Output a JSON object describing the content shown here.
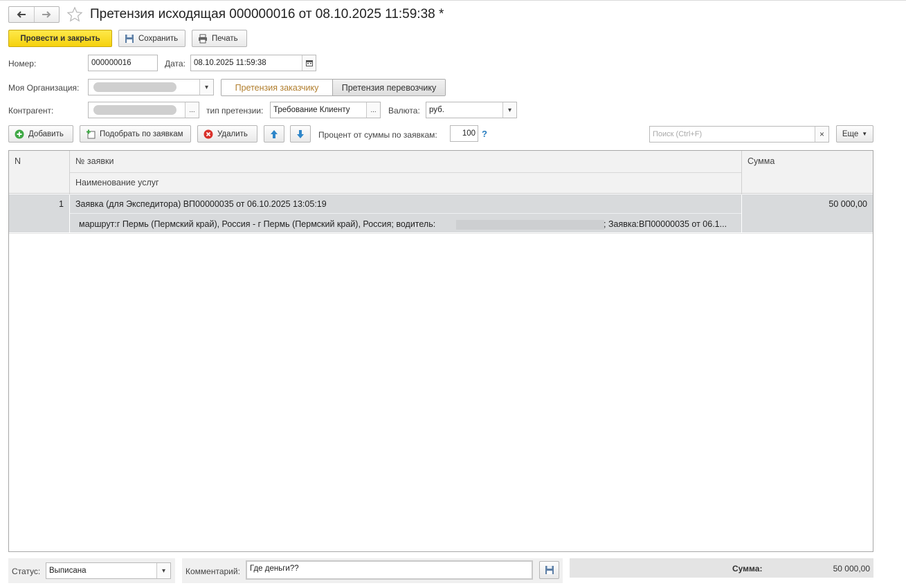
{
  "window": {
    "title": "Претензия исходящая 000000016 от 08.10.2025 11:59:38 *"
  },
  "toolbar": {
    "post_close": "Провести и закрыть",
    "save": "Сохранить",
    "print": "Печать"
  },
  "form": {
    "number_label": "Номер:",
    "number_value": "000000016",
    "date_label": "Дата:",
    "date_value": "08.10.2025 11:59:38",
    "org_label": "Моя Организация:",
    "counterparty_label": "Контрагент:",
    "claim_type_label": "тип претензии:",
    "claim_type_value": "Требование Клиенту",
    "currency_label": "Валюта:",
    "currency_value": "руб.",
    "tabs": [
      "Претензия заказчику",
      "Претензия перевозчику"
    ]
  },
  "table_toolbar": {
    "add": "Добавить",
    "pick": "Подобрать по заявкам",
    "delete": "Удалить",
    "percent_label": "Процент от суммы по заявкам:",
    "percent_value": "100",
    "help": "?",
    "search_placeholder": "Поиск (Ctrl+F)",
    "more": "Еще"
  },
  "table": {
    "headers": {
      "n": "N",
      "order": "№ заявки",
      "services": "Наименование услуг",
      "sum": "Сумма"
    },
    "rows": [
      {
        "n": "1",
        "order": "Заявка (для Экспедитора) ВП00000035 от 06.10.2025 13:05:19",
        "services_prefix": "маршрут:г Пермь (Пермский край), Россия - г Пермь (Пермский край), Россия; водитель:",
        "services_suffix": "; Заявка:ВП00000035 от 06.1...",
        "sum": "50 000,00"
      }
    ]
  },
  "footer": {
    "status_label": "Статус:",
    "status_value": "Выписана",
    "comment_label": "Комментарий:",
    "comment_value": "Где деньги??",
    "sum_label": "Сумма:",
    "sum_value": "50 000,00"
  },
  "colors": {
    "primary_button": "#f5d10e",
    "active_tab_text": "#b07d2c",
    "selected_row": "#d8dadc",
    "help_link": "#2a7fc0"
  }
}
